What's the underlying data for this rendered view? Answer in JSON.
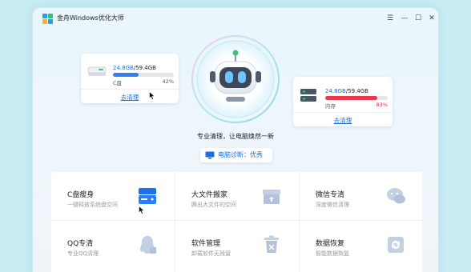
{
  "window": {
    "title": "金舟Windows优化大师",
    "logo_colors": [
      "#2f9be8",
      "#31c36e",
      "#f7b52a",
      "#e94b5b"
    ]
  },
  "disk": {
    "used": "24.8GB",
    "total": "/59.4GB",
    "name": "C盘",
    "percent_text": "42%",
    "percent": 42,
    "clean_label": "去清理",
    "bar_color": "#2f7ff0"
  },
  "memory": {
    "used": "24.8GB",
    "total": "/59.4GB",
    "name": "内存",
    "percent_text": "83%",
    "percent": 83,
    "clean_label": "去清理",
    "bar_color": "#e8394d"
  },
  "tagline": "专业清理，让电脑焕然一新",
  "diagnosis": "电脑诊断：优秀",
  "tiles": [
    {
      "title": "C盘瘦身",
      "subtitle": "一键释放系统盘空间",
      "icon": "disk-slim-icon"
    },
    {
      "title": "大文件搬家",
      "subtitle": "腾出大文件的空间",
      "icon": "box-move-icon"
    },
    {
      "title": "微信专清",
      "subtitle": "深度微信清理",
      "icon": "wechat-clean-icon"
    },
    {
      "title": "QQ专清",
      "subtitle": "专业QQ清理",
      "icon": "qq-clean-icon"
    },
    {
      "title": "软件管理",
      "subtitle": "卸载软件无残留",
      "icon": "trash-icon"
    },
    {
      "title": "数据恢复",
      "subtitle": "智能数据恢复",
      "icon": "data-recovery-icon"
    }
  ],
  "colors": {
    "accent": "#1a6fd8",
    "icon_primary": "#1f6fe6",
    "icon_muted": "#b9c6dd"
  }
}
